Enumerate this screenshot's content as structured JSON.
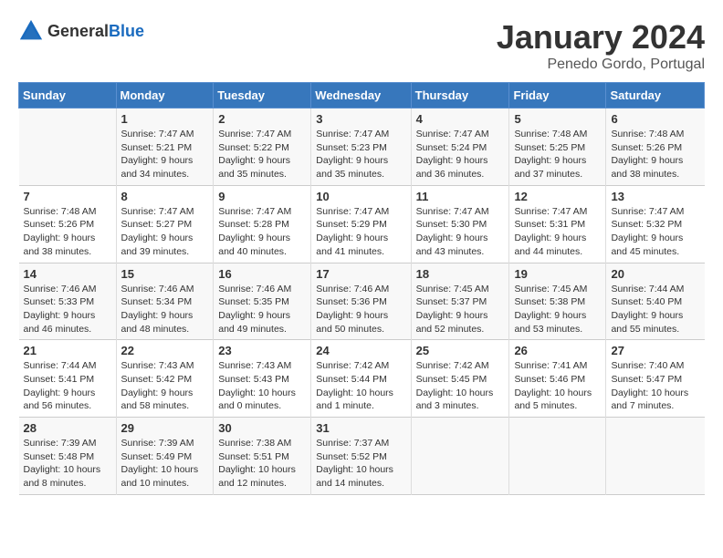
{
  "header": {
    "logo_general": "General",
    "logo_blue": "Blue",
    "month_year": "January 2024",
    "location": "Penedo Gordo, Portugal"
  },
  "weekdays": [
    "Sunday",
    "Monday",
    "Tuesday",
    "Wednesday",
    "Thursday",
    "Friday",
    "Saturday"
  ],
  "weeks": [
    [
      {
        "day": "",
        "sunrise": "",
        "sunset": "",
        "daylight": ""
      },
      {
        "day": "1",
        "sunrise": "Sunrise: 7:47 AM",
        "sunset": "Sunset: 5:21 PM",
        "daylight": "Daylight: 9 hours and 34 minutes."
      },
      {
        "day": "2",
        "sunrise": "Sunrise: 7:47 AM",
        "sunset": "Sunset: 5:22 PM",
        "daylight": "Daylight: 9 hours and 35 minutes."
      },
      {
        "day": "3",
        "sunrise": "Sunrise: 7:47 AM",
        "sunset": "Sunset: 5:23 PM",
        "daylight": "Daylight: 9 hours and 35 minutes."
      },
      {
        "day": "4",
        "sunrise": "Sunrise: 7:47 AM",
        "sunset": "Sunset: 5:24 PM",
        "daylight": "Daylight: 9 hours and 36 minutes."
      },
      {
        "day": "5",
        "sunrise": "Sunrise: 7:48 AM",
        "sunset": "Sunset: 5:25 PM",
        "daylight": "Daylight: 9 hours and 37 minutes."
      },
      {
        "day": "6",
        "sunrise": "Sunrise: 7:48 AM",
        "sunset": "Sunset: 5:26 PM",
        "daylight": "Daylight: 9 hours and 38 minutes."
      }
    ],
    [
      {
        "day": "7",
        "sunrise": "Sunrise: 7:48 AM",
        "sunset": "Sunset: 5:26 PM",
        "daylight": "Daylight: 9 hours and 38 minutes."
      },
      {
        "day": "8",
        "sunrise": "Sunrise: 7:47 AM",
        "sunset": "Sunset: 5:27 PM",
        "daylight": "Daylight: 9 hours and 39 minutes."
      },
      {
        "day": "9",
        "sunrise": "Sunrise: 7:47 AM",
        "sunset": "Sunset: 5:28 PM",
        "daylight": "Daylight: 9 hours and 40 minutes."
      },
      {
        "day": "10",
        "sunrise": "Sunrise: 7:47 AM",
        "sunset": "Sunset: 5:29 PM",
        "daylight": "Daylight: 9 hours and 41 minutes."
      },
      {
        "day": "11",
        "sunrise": "Sunrise: 7:47 AM",
        "sunset": "Sunset: 5:30 PM",
        "daylight": "Daylight: 9 hours and 43 minutes."
      },
      {
        "day": "12",
        "sunrise": "Sunrise: 7:47 AM",
        "sunset": "Sunset: 5:31 PM",
        "daylight": "Daylight: 9 hours and 44 minutes."
      },
      {
        "day": "13",
        "sunrise": "Sunrise: 7:47 AM",
        "sunset": "Sunset: 5:32 PM",
        "daylight": "Daylight: 9 hours and 45 minutes."
      }
    ],
    [
      {
        "day": "14",
        "sunrise": "Sunrise: 7:46 AM",
        "sunset": "Sunset: 5:33 PM",
        "daylight": "Daylight: 9 hours and 46 minutes."
      },
      {
        "day": "15",
        "sunrise": "Sunrise: 7:46 AM",
        "sunset": "Sunset: 5:34 PM",
        "daylight": "Daylight: 9 hours and 48 minutes."
      },
      {
        "day": "16",
        "sunrise": "Sunrise: 7:46 AM",
        "sunset": "Sunset: 5:35 PM",
        "daylight": "Daylight: 9 hours and 49 minutes."
      },
      {
        "day": "17",
        "sunrise": "Sunrise: 7:46 AM",
        "sunset": "Sunset: 5:36 PM",
        "daylight": "Daylight: 9 hours and 50 minutes."
      },
      {
        "day": "18",
        "sunrise": "Sunrise: 7:45 AM",
        "sunset": "Sunset: 5:37 PM",
        "daylight": "Daylight: 9 hours and 52 minutes."
      },
      {
        "day": "19",
        "sunrise": "Sunrise: 7:45 AM",
        "sunset": "Sunset: 5:38 PM",
        "daylight": "Daylight: 9 hours and 53 minutes."
      },
      {
        "day": "20",
        "sunrise": "Sunrise: 7:44 AM",
        "sunset": "Sunset: 5:40 PM",
        "daylight": "Daylight: 9 hours and 55 minutes."
      }
    ],
    [
      {
        "day": "21",
        "sunrise": "Sunrise: 7:44 AM",
        "sunset": "Sunset: 5:41 PM",
        "daylight": "Daylight: 9 hours and 56 minutes."
      },
      {
        "day": "22",
        "sunrise": "Sunrise: 7:43 AM",
        "sunset": "Sunset: 5:42 PM",
        "daylight": "Daylight: 9 hours and 58 minutes."
      },
      {
        "day": "23",
        "sunrise": "Sunrise: 7:43 AM",
        "sunset": "Sunset: 5:43 PM",
        "daylight": "Daylight: 10 hours and 0 minutes."
      },
      {
        "day": "24",
        "sunrise": "Sunrise: 7:42 AM",
        "sunset": "Sunset: 5:44 PM",
        "daylight": "Daylight: 10 hours and 1 minute."
      },
      {
        "day": "25",
        "sunrise": "Sunrise: 7:42 AM",
        "sunset": "Sunset: 5:45 PM",
        "daylight": "Daylight: 10 hours and 3 minutes."
      },
      {
        "day": "26",
        "sunrise": "Sunrise: 7:41 AM",
        "sunset": "Sunset: 5:46 PM",
        "daylight": "Daylight: 10 hours and 5 minutes."
      },
      {
        "day": "27",
        "sunrise": "Sunrise: 7:40 AM",
        "sunset": "Sunset: 5:47 PM",
        "daylight": "Daylight: 10 hours and 7 minutes."
      }
    ],
    [
      {
        "day": "28",
        "sunrise": "Sunrise: 7:39 AM",
        "sunset": "Sunset: 5:48 PM",
        "daylight": "Daylight: 10 hours and 8 minutes."
      },
      {
        "day": "29",
        "sunrise": "Sunrise: 7:39 AM",
        "sunset": "Sunset: 5:49 PM",
        "daylight": "Daylight: 10 hours and 10 minutes."
      },
      {
        "day": "30",
        "sunrise": "Sunrise: 7:38 AM",
        "sunset": "Sunset: 5:51 PM",
        "daylight": "Daylight: 10 hours and 12 minutes."
      },
      {
        "day": "31",
        "sunrise": "Sunrise: 7:37 AM",
        "sunset": "Sunset: 5:52 PM",
        "daylight": "Daylight: 10 hours and 14 minutes."
      },
      {
        "day": "",
        "sunrise": "",
        "sunset": "",
        "daylight": ""
      },
      {
        "day": "",
        "sunrise": "",
        "sunset": "",
        "daylight": ""
      },
      {
        "day": "",
        "sunrise": "",
        "sunset": "",
        "daylight": ""
      }
    ]
  ]
}
